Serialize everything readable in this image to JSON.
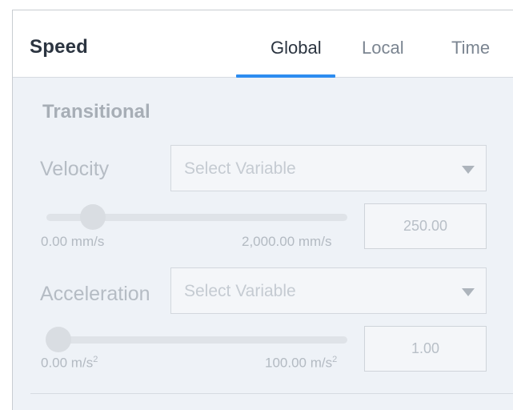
{
  "header": {
    "title": "Speed",
    "tabs": [
      {
        "label": "Global",
        "active": true
      },
      {
        "label": "Local",
        "active": false
      },
      {
        "label": "Time",
        "active": false
      }
    ]
  },
  "colors": {
    "accent": "#2d8cf0",
    "disabled_text": "#b5bcc4",
    "panel_background": "#eef2f7"
  },
  "section": {
    "title": "Transitional"
  },
  "velocity": {
    "label": "Velocity",
    "select_placeholder": "Select Variable",
    "slider_min_label": "0.00 mm/s",
    "slider_max_label": "2,000.00 mm/s",
    "value": "250.00",
    "slider_fraction": 0.125
  },
  "acceleration": {
    "label": "Acceleration",
    "select_placeholder": "Select Variable",
    "slider_min_value": "0.00 m/s",
    "slider_max_value": "100.00 m/s",
    "unit_superscript": "2",
    "value": "1.00",
    "slider_fraction": 0.01
  }
}
